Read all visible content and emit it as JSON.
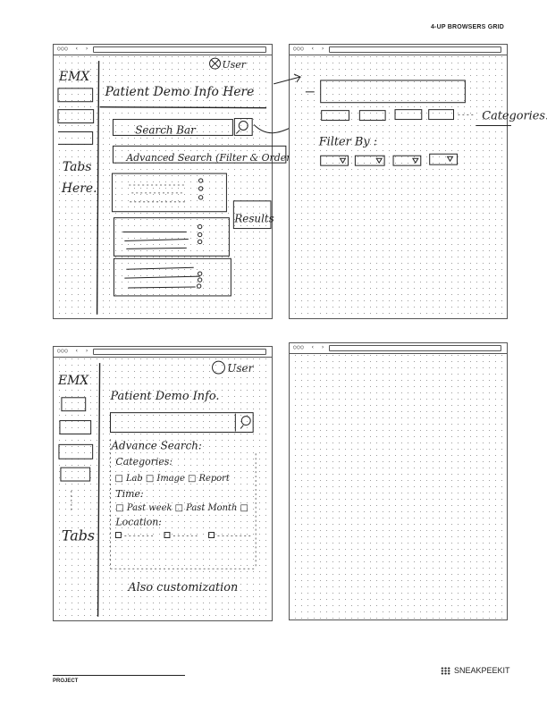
{
  "header": {
    "title": "4-UP BROWSERS GRID"
  },
  "browser_chrome": {
    "dots": "○○○",
    "nav": "‹ ›"
  },
  "sketch1": {
    "user": "User",
    "logo": "EMX",
    "patient_info": "Patient Demo Info Here",
    "search_bar": "Search Bar",
    "advanced_search": "Advanced Search (Filter & Order)",
    "tabs_line1": "Tabs",
    "tabs_line2": "Here.",
    "results": "Results"
  },
  "sketch2": {
    "categories_label": "Categories.",
    "filter_by": "Filter By :"
  },
  "sketch3": {
    "user": "User",
    "logo": "EMX",
    "patient_info": "Patient Demo Info.",
    "advance_search": "Advance Search:",
    "categories": "Categories:",
    "cat_options": "□ Lab  □ Image  □ Report",
    "time": "Time:",
    "time_options": "□ Past week  □ Past Month □",
    "location": "Location:",
    "tabs": "Tabs",
    "customization": "Also customization"
  },
  "footer": {
    "project": "PROJECT",
    "brand": "SNEAKPEEKIT"
  }
}
